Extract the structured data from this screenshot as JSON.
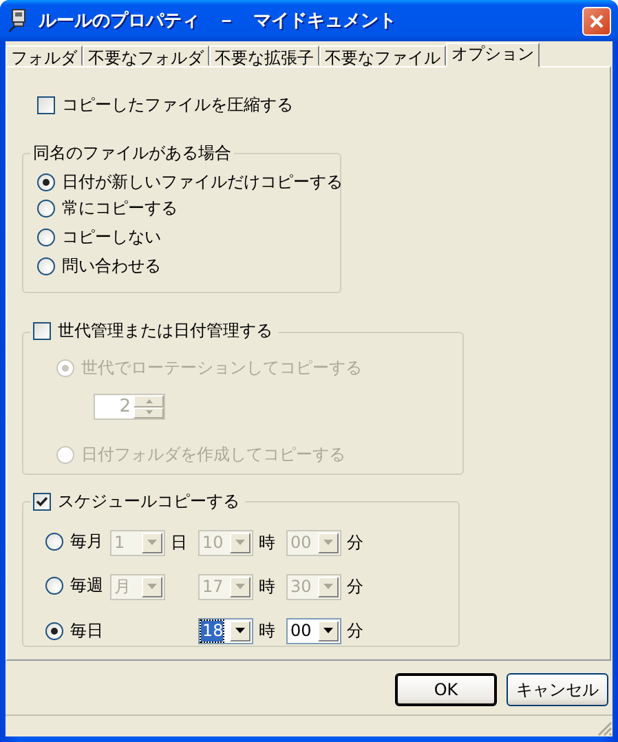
{
  "window": {
    "title": "ルールのプロパティ　－　マイドキュメント"
  },
  "tabs": [
    {
      "label": "フォルダ",
      "selected": false
    },
    {
      "label": "不要なフォルダ",
      "selected": false
    },
    {
      "label": "不要な拡張子",
      "selected": false
    },
    {
      "label": "不要なファイル",
      "selected": false
    },
    {
      "label": "オプション",
      "selected": true
    }
  ],
  "compress": {
    "label": "コピーしたファイルを圧縮する",
    "checked": false
  },
  "same_name": {
    "title": "同名のファイルがある場合",
    "options": [
      {
        "label": "日付が新しいファイルだけコピーする",
        "selected": true
      },
      {
        "label": "常にコピーする",
        "selected": false
      },
      {
        "label": "コピーしない",
        "selected": false
      },
      {
        "label": "問い合わせる",
        "selected": false
      }
    ]
  },
  "generation": {
    "label": "世代管理または日付管理する",
    "checked": false,
    "count": "2",
    "options": [
      {
        "label": "世代でローテーションしてコピーする",
        "selected": true
      },
      {
        "label": "日付フォルダを作成してコピーする",
        "selected": false
      }
    ]
  },
  "schedule": {
    "label": "スケジュールコピーする",
    "checked": true,
    "rows": [
      {
        "label": "毎月",
        "selected": false,
        "fields": [
          {
            "kind": "day",
            "value": "1",
            "unit": "日",
            "focused": false
          },
          {
            "kind": "hour",
            "value": "10",
            "unit": "時",
            "focused": false
          },
          {
            "kind": "minute",
            "value": "00",
            "unit": "分",
            "focused": false
          }
        ]
      },
      {
        "label": "毎週",
        "selected": false,
        "fields": [
          {
            "kind": "day",
            "value": "月",
            "focused": false
          },
          {
            "kind": "hour",
            "value": "17",
            "unit": "時",
            "focused": false
          },
          {
            "kind": "minute",
            "value": "30",
            "unit": "分",
            "focused": false
          }
        ]
      },
      {
        "label": "毎日",
        "selected": true,
        "fields": [
          {
            "kind": "hour",
            "value": "18",
            "unit": "時",
            "focused": true
          },
          {
            "kind": "minute",
            "value": "00",
            "unit": "分",
            "focused": false
          }
        ]
      }
    ]
  },
  "buttons": [
    {
      "label": "OK",
      "default": true
    },
    {
      "label": "キャンセル",
      "default": false
    }
  ]
}
